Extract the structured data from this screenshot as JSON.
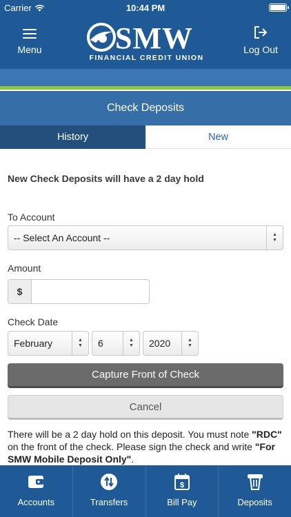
{
  "status_bar": {
    "carrier": "Carrier",
    "time": "10:44 PM"
  },
  "header": {
    "menu_label": "Menu",
    "logout_label": "Log Out",
    "logo_name": "SMW",
    "logo_subtitle": "FINANCIAL CREDIT UNION"
  },
  "page_title": "Check Deposits",
  "tabs": [
    {
      "label": "History",
      "active": false
    },
    {
      "label": "New",
      "active": true
    }
  ],
  "form": {
    "hold_notice": "New Check Deposits will have a 2 day hold",
    "to_account_label": "To Account",
    "to_account_value": "-- Select An Account --",
    "amount_label": "Amount",
    "amount_prefix": "$",
    "amount_value": "",
    "check_date_label": "Check Date",
    "month_value": "February",
    "day_value": "6",
    "year_value": "2020",
    "capture_button": "Capture Front of Check",
    "cancel_button": "Cancel"
  },
  "disclaimer": {
    "part1": "There will be a 2 day hold on this deposit. You must note ",
    "rdc": "\"RDC\"",
    "part2": " on the front of the check. Please sign the check and write ",
    "endorse": "\"For SMW Mobile Deposit Only\"",
    "part3": "."
  },
  "bottom_nav": [
    {
      "label": "Accounts",
      "icon": "wallet-icon"
    },
    {
      "label": "Transfers",
      "icon": "transfer-arrows-icon"
    },
    {
      "label": "Bill Pay",
      "icon": "calendar-dollar-icon"
    },
    {
      "label": "Deposits",
      "icon": "check-deposit-icon"
    }
  ],
  "colors": {
    "primary": "#1f5a96",
    "accent_green": "#8dc63f",
    "tab_active_text": "#2e6aa6",
    "capture_button": "#6b6b6b"
  }
}
